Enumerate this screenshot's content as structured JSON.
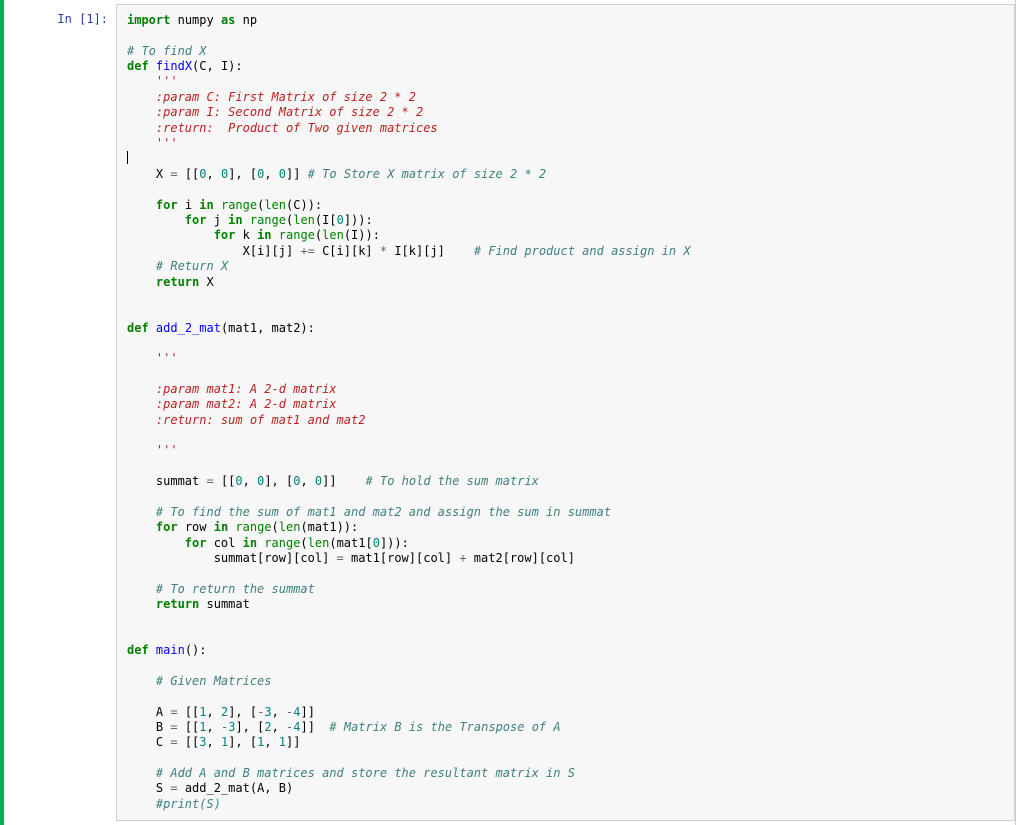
{
  "prompt": "In [1]:",
  "code": {
    "tokens": [
      {
        "cls": "tok-kw",
        "t": "import"
      },
      {
        "cls": "",
        "t": " "
      },
      {
        "cls": "tok-name",
        "t": "numpy"
      },
      {
        "cls": "",
        "t": " "
      },
      {
        "cls": "tok-kw",
        "t": "as"
      },
      {
        "cls": "",
        "t": " "
      },
      {
        "cls": "tok-name",
        "t": "np"
      },
      {
        "cls": "",
        "t": "\n"
      },
      {
        "cls": "",
        "t": "\n"
      },
      {
        "cls": "tok-cmt",
        "t": "# To find X"
      },
      {
        "cls": "",
        "t": "\n"
      },
      {
        "cls": "tok-kw",
        "t": "def"
      },
      {
        "cls": "",
        "t": " "
      },
      {
        "cls": "tok-func",
        "t": "findX"
      },
      {
        "cls": "",
        "t": "(C, I):"
      },
      {
        "cls": "",
        "t": "\n"
      },
      {
        "cls": "",
        "t": "    "
      },
      {
        "cls": "tok-doc",
        "t": "'''"
      },
      {
        "cls": "",
        "t": "\n"
      },
      {
        "cls": "tok-doc",
        "t": "    :param C: First Matrix of size 2 * 2"
      },
      {
        "cls": "",
        "t": "\n"
      },
      {
        "cls": "tok-doc",
        "t": "    :param I: Second Matrix of size 2 * 2"
      },
      {
        "cls": "",
        "t": "\n"
      },
      {
        "cls": "tok-doc",
        "t": "    :return:  Product of Two given matrices"
      },
      {
        "cls": "",
        "t": "\n"
      },
      {
        "cls": "tok-doc",
        "t": "    '''"
      },
      {
        "cls": "",
        "t": "\n"
      },
      {
        "cls": "cursor",
        "t": ""
      },
      {
        "cls": "",
        "t": "\n"
      },
      {
        "cls": "",
        "t": "    X "
      },
      {
        "cls": "tok-op",
        "t": "="
      },
      {
        "cls": "",
        "t": " [["
      },
      {
        "cls": "tok-num",
        "t": "0"
      },
      {
        "cls": "",
        "t": ", "
      },
      {
        "cls": "tok-num",
        "t": "0"
      },
      {
        "cls": "",
        "t": "], ["
      },
      {
        "cls": "tok-num",
        "t": "0"
      },
      {
        "cls": "",
        "t": ", "
      },
      {
        "cls": "tok-num",
        "t": "0"
      },
      {
        "cls": "",
        "t": "]] "
      },
      {
        "cls": "tok-cmt",
        "t": "# To Store X matrix of size 2 * 2"
      },
      {
        "cls": "",
        "t": "\n"
      },
      {
        "cls": "",
        "t": "\n"
      },
      {
        "cls": "",
        "t": "    "
      },
      {
        "cls": "tok-kw",
        "t": "for"
      },
      {
        "cls": "",
        "t": " i "
      },
      {
        "cls": "tok-kw",
        "t": "in"
      },
      {
        "cls": "",
        "t": " "
      },
      {
        "cls": "tok-builtin",
        "t": "range"
      },
      {
        "cls": "",
        "t": "("
      },
      {
        "cls": "tok-builtin",
        "t": "len"
      },
      {
        "cls": "",
        "t": "(C)):"
      },
      {
        "cls": "",
        "t": "\n"
      },
      {
        "cls": "",
        "t": "        "
      },
      {
        "cls": "tok-kw",
        "t": "for"
      },
      {
        "cls": "",
        "t": " j "
      },
      {
        "cls": "tok-kw",
        "t": "in"
      },
      {
        "cls": "",
        "t": " "
      },
      {
        "cls": "tok-builtin",
        "t": "range"
      },
      {
        "cls": "",
        "t": "("
      },
      {
        "cls": "tok-builtin",
        "t": "len"
      },
      {
        "cls": "",
        "t": "(I["
      },
      {
        "cls": "tok-num",
        "t": "0"
      },
      {
        "cls": "",
        "t": "])):"
      },
      {
        "cls": "",
        "t": "\n"
      },
      {
        "cls": "",
        "t": "            "
      },
      {
        "cls": "tok-kw",
        "t": "for"
      },
      {
        "cls": "",
        "t": " k "
      },
      {
        "cls": "tok-kw",
        "t": "in"
      },
      {
        "cls": "",
        "t": " "
      },
      {
        "cls": "tok-builtin",
        "t": "range"
      },
      {
        "cls": "",
        "t": "("
      },
      {
        "cls": "tok-builtin",
        "t": "len"
      },
      {
        "cls": "",
        "t": "(I)):"
      },
      {
        "cls": "",
        "t": "\n"
      },
      {
        "cls": "",
        "t": "                X[i][j] "
      },
      {
        "cls": "tok-op",
        "t": "+="
      },
      {
        "cls": "",
        "t": " C[i][k] "
      },
      {
        "cls": "tok-op",
        "t": "*"
      },
      {
        "cls": "",
        "t": " I[k][j]    "
      },
      {
        "cls": "tok-cmt",
        "t": "# Find product and assign in X"
      },
      {
        "cls": "",
        "t": "\n"
      },
      {
        "cls": "",
        "t": "    "
      },
      {
        "cls": "tok-cmt",
        "t": "# Return X"
      },
      {
        "cls": "",
        "t": "\n"
      },
      {
        "cls": "",
        "t": "    "
      },
      {
        "cls": "tok-kw",
        "t": "return"
      },
      {
        "cls": "",
        "t": " X"
      },
      {
        "cls": "",
        "t": "\n"
      },
      {
        "cls": "",
        "t": "\n"
      },
      {
        "cls": "",
        "t": "\n"
      },
      {
        "cls": "tok-kw",
        "t": "def"
      },
      {
        "cls": "",
        "t": " "
      },
      {
        "cls": "tok-func",
        "t": "add_2_mat"
      },
      {
        "cls": "",
        "t": "(mat1, mat2):"
      },
      {
        "cls": "",
        "t": "\n"
      },
      {
        "cls": "",
        "t": "\n"
      },
      {
        "cls": "",
        "t": "    "
      },
      {
        "cls": "tok-doc",
        "t": "'''"
      },
      {
        "cls": "",
        "t": "\n"
      },
      {
        "cls": "",
        "t": "\n"
      },
      {
        "cls": "tok-doc",
        "t": "    :param mat1: A 2-d matrix"
      },
      {
        "cls": "",
        "t": "\n"
      },
      {
        "cls": "tok-doc",
        "t": "    :param mat2: A 2-d matrix"
      },
      {
        "cls": "",
        "t": "\n"
      },
      {
        "cls": "tok-doc",
        "t": "    :return: sum of mat1 and mat2"
      },
      {
        "cls": "",
        "t": "\n"
      },
      {
        "cls": "",
        "t": "\n"
      },
      {
        "cls": "tok-doc",
        "t": "    '''"
      },
      {
        "cls": "",
        "t": "\n"
      },
      {
        "cls": "",
        "t": "\n"
      },
      {
        "cls": "",
        "t": "    summat "
      },
      {
        "cls": "tok-op",
        "t": "="
      },
      {
        "cls": "",
        "t": " [["
      },
      {
        "cls": "tok-num",
        "t": "0"
      },
      {
        "cls": "",
        "t": ", "
      },
      {
        "cls": "tok-num",
        "t": "0"
      },
      {
        "cls": "",
        "t": "], ["
      },
      {
        "cls": "tok-num",
        "t": "0"
      },
      {
        "cls": "",
        "t": ", "
      },
      {
        "cls": "tok-num",
        "t": "0"
      },
      {
        "cls": "",
        "t": "]]    "
      },
      {
        "cls": "tok-cmt",
        "t": "# To hold the sum matrix"
      },
      {
        "cls": "",
        "t": "\n"
      },
      {
        "cls": "",
        "t": "\n"
      },
      {
        "cls": "",
        "t": "    "
      },
      {
        "cls": "tok-cmt",
        "t": "# To find the sum of mat1 and mat2 and assign the sum in summat"
      },
      {
        "cls": "",
        "t": "\n"
      },
      {
        "cls": "",
        "t": "    "
      },
      {
        "cls": "tok-kw",
        "t": "for"
      },
      {
        "cls": "",
        "t": " row "
      },
      {
        "cls": "tok-kw",
        "t": "in"
      },
      {
        "cls": "",
        "t": " "
      },
      {
        "cls": "tok-builtin",
        "t": "range"
      },
      {
        "cls": "",
        "t": "("
      },
      {
        "cls": "tok-builtin",
        "t": "len"
      },
      {
        "cls": "",
        "t": "(mat1)):"
      },
      {
        "cls": "",
        "t": "\n"
      },
      {
        "cls": "",
        "t": "        "
      },
      {
        "cls": "tok-kw",
        "t": "for"
      },
      {
        "cls": "",
        "t": " col "
      },
      {
        "cls": "tok-kw",
        "t": "in"
      },
      {
        "cls": "",
        "t": " "
      },
      {
        "cls": "tok-builtin",
        "t": "range"
      },
      {
        "cls": "",
        "t": "("
      },
      {
        "cls": "tok-builtin",
        "t": "len"
      },
      {
        "cls": "",
        "t": "(mat1["
      },
      {
        "cls": "tok-num",
        "t": "0"
      },
      {
        "cls": "",
        "t": "])):"
      },
      {
        "cls": "",
        "t": "\n"
      },
      {
        "cls": "",
        "t": "            summat[row][col] "
      },
      {
        "cls": "tok-op",
        "t": "="
      },
      {
        "cls": "",
        "t": " mat1[row][col] "
      },
      {
        "cls": "tok-op",
        "t": "+"
      },
      {
        "cls": "",
        "t": " mat2[row][col]"
      },
      {
        "cls": "",
        "t": "\n"
      },
      {
        "cls": "",
        "t": "\n"
      },
      {
        "cls": "",
        "t": "    "
      },
      {
        "cls": "tok-cmt",
        "t": "# To return the summat"
      },
      {
        "cls": "",
        "t": "\n"
      },
      {
        "cls": "",
        "t": "    "
      },
      {
        "cls": "tok-kw",
        "t": "return"
      },
      {
        "cls": "",
        "t": " summat"
      },
      {
        "cls": "",
        "t": "\n"
      },
      {
        "cls": "",
        "t": "\n"
      },
      {
        "cls": "",
        "t": "\n"
      },
      {
        "cls": "tok-kw",
        "t": "def"
      },
      {
        "cls": "",
        "t": " "
      },
      {
        "cls": "tok-func",
        "t": "main"
      },
      {
        "cls": "",
        "t": "():"
      },
      {
        "cls": "",
        "t": "\n"
      },
      {
        "cls": "",
        "t": "\n"
      },
      {
        "cls": "",
        "t": "    "
      },
      {
        "cls": "tok-cmt",
        "t": "# Given Matrices"
      },
      {
        "cls": "",
        "t": "\n"
      },
      {
        "cls": "",
        "t": "\n"
      },
      {
        "cls": "",
        "t": "    A "
      },
      {
        "cls": "tok-op",
        "t": "="
      },
      {
        "cls": "",
        "t": " [["
      },
      {
        "cls": "tok-num",
        "t": "1"
      },
      {
        "cls": "",
        "t": ", "
      },
      {
        "cls": "tok-num",
        "t": "2"
      },
      {
        "cls": "",
        "t": "], ["
      },
      {
        "cls": "tok-op",
        "t": "-"
      },
      {
        "cls": "tok-num",
        "t": "3"
      },
      {
        "cls": "",
        "t": ", "
      },
      {
        "cls": "tok-op",
        "t": "-"
      },
      {
        "cls": "tok-num",
        "t": "4"
      },
      {
        "cls": "",
        "t": "]]"
      },
      {
        "cls": "",
        "t": "\n"
      },
      {
        "cls": "",
        "t": "    B "
      },
      {
        "cls": "tok-op",
        "t": "="
      },
      {
        "cls": "",
        "t": " [["
      },
      {
        "cls": "tok-num",
        "t": "1"
      },
      {
        "cls": "",
        "t": ", "
      },
      {
        "cls": "tok-op",
        "t": "-"
      },
      {
        "cls": "tok-num",
        "t": "3"
      },
      {
        "cls": "",
        "t": "], ["
      },
      {
        "cls": "tok-num",
        "t": "2"
      },
      {
        "cls": "",
        "t": ", "
      },
      {
        "cls": "tok-op",
        "t": "-"
      },
      {
        "cls": "tok-num",
        "t": "4"
      },
      {
        "cls": "",
        "t": "]]  "
      },
      {
        "cls": "tok-cmt",
        "t": "# Matrix B is the Transpose of A"
      },
      {
        "cls": "",
        "t": "\n"
      },
      {
        "cls": "",
        "t": "    C "
      },
      {
        "cls": "tok-op",
        "t": "="
      },
      {
        "cls": "",
        "t": " [["
      },
      {
        "cls": "tok-num",
        "t": "3"
      },
      {
        "cls": "",
        "t": ", "
      },
      {
        "cls": "tok-num",
        "t": "1"
      },
      {
        "cls": "",
        "t": "], ["
      },
      {
        "cls": "tok-num",
        "t": "1"
      },
      {
        "cls": "",
        "t": ", "
      },
      {
        "cls": "tok-num",
        "t": "1"
      },
      {
        "cls": "",
        "t": "]]"
      },
      {
        "cls": "",
        "t": "\n"
      },
      {
        "cls": "",
        "t": "\n"
      },
      {
        "cls": "",
        "t": "    "
      },
      {
        "cls": "tok-cmt",
        "t": "# Add A and B matrices and store the resultant matrix in S"
      },
      {
        "cls": "",
        "t": "\n"
      },
      {
        "cls": "",
        "t": "    S "
      },
      {
        "cls": "tok-op",
        "t": "="
      },
      {
        "cls": "",
        "t": " add_2_mat(A, B)"
      },
      {
        "cls": "",
        "t": "\n"
      },
      {
        "cls": "",
        "t": "    "
      },
      {
        "cls": "tok-cmt",
        "t": "#print(S)"
      },
      {
        "cls": "",
        "t": "\n"
      }
    ]
  }
}
